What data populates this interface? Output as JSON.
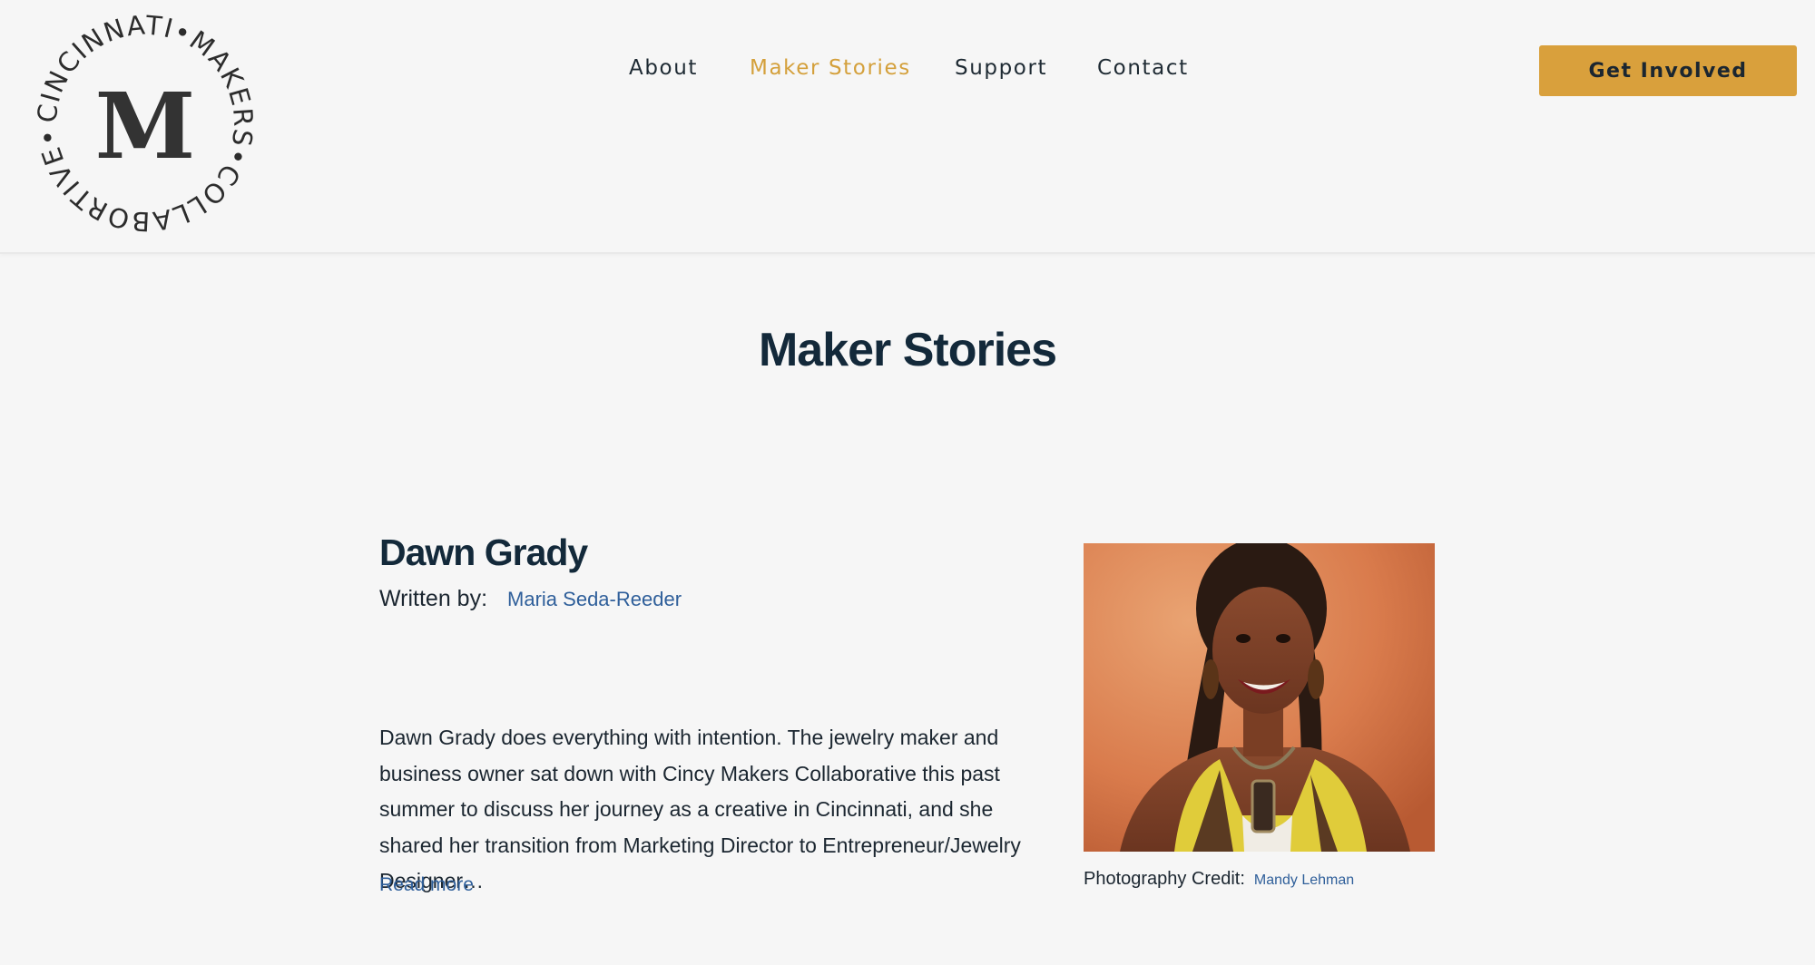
{
  "header": {
    "logo": {
      "arc_text": "CINCINNATI•MAKERS•COLLABORTIVE•",
      "monogram": "M"
    },
    "nav": [
      {
        "label": "About",
        "active": false
      },
      {
        "label": "Maker Stories",
        "active": true
      },
      {
        "label": "Support",
        "active": false
      },
      {
        "label": "Contact",
        "active": false
      }
    ],
    "cta_label": "Get Involved"
  },
  "page": {
    "title": "Maker Stories"
  },
  "story": {
    "title": "Dawn Grady",
    "written_by_label": "Written by:",
    "author": "Maria Seda-Reeder",
    "excerpt": "Dawn Grady does everything with intention. The jewelry maker and business owner sat down with Cincy Makers Collaborative this past summer to discuss her journey as a creative in Cincinnati, and she shared her transition from Marketing Director to Entrepreneur/Jewelry Designer…",
    "read_more": "Read more",
    "photo_credit_label": "Photography Credit:",
    "photographer": "Mandy Lehman"
  },
  "colors": {
    "accent": "#d9a03c",
    "nav_active": "#d4a03b",
    "heading": "#13293a",
    "link": "#2f5f9a",
    "background": "#f6f6f6"
  }
}
